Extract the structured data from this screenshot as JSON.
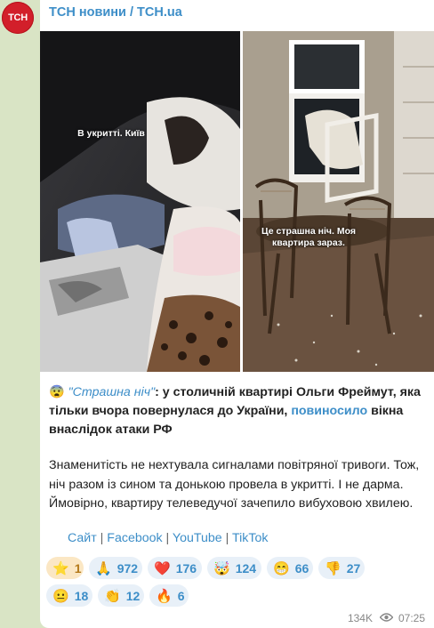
{
  "channel": {
    "avatar_text": "ТСН",
    "name": "ТСН новини / TCH.ua"
  },
  "media": {
    "left_caption": "В укритті. Київ",
    "right_caption": "Це страшна ніч. Моя квартира зараз."
  },
  "message": {
    "emoji": "😨",
    "quote": "\"Страшна ніч\"",
    "part1": ": у столичній квартирі Ольги Фреймут, яка тільки вчора повернулася до України, ",
    "link": "повиносило",
    "part2": " вікна внаслідок атаки РФ",
    "paragraph2": "Знаменитість не нехтувала сигналами повітряної тривоги. Тож, ніч разом із сином та донькою провела в укритті. І не дарма. Ймовірно, квартиру телеведучої зачепило вибуховою хвилею."
  },
  "links": {
    "site": "Сайт",
    "facebook": "Facebook",
    "youtube": "YouTube",
    "tiktok": "TikTok",
    "sep": " | "
  },
  "reactions": [
    {
      "emoji": "⭐",
      "count": "1"
    },
    {
      "emoji": "🙏",
      "count": "972"
    },
    {
      "emoji": "❤️",
      "count": "176"
    },
    {
      "emoji": "🤯",
      "count": "124"
    },
    {
      "emoji": "😁",
      "count": "66"
    },
    {
      "emoji": "👎",
      "count": "27"
    },
    {
      "emoji": "😐",
      "count": "18"
    },
    {
      "emoji": "👏",
      "count": "12"
    },
    {
      "emoji": "🔥",
      "count": "6"
    }
  ],
  "meta": {
    "views": "134K",
    "time": "07:25"
  },
  "colors": {
    "link": "#3d8ec8",
    "avatar": "#d21f2a",
    "chat_bg": "#d9e4c5"
  }
}
